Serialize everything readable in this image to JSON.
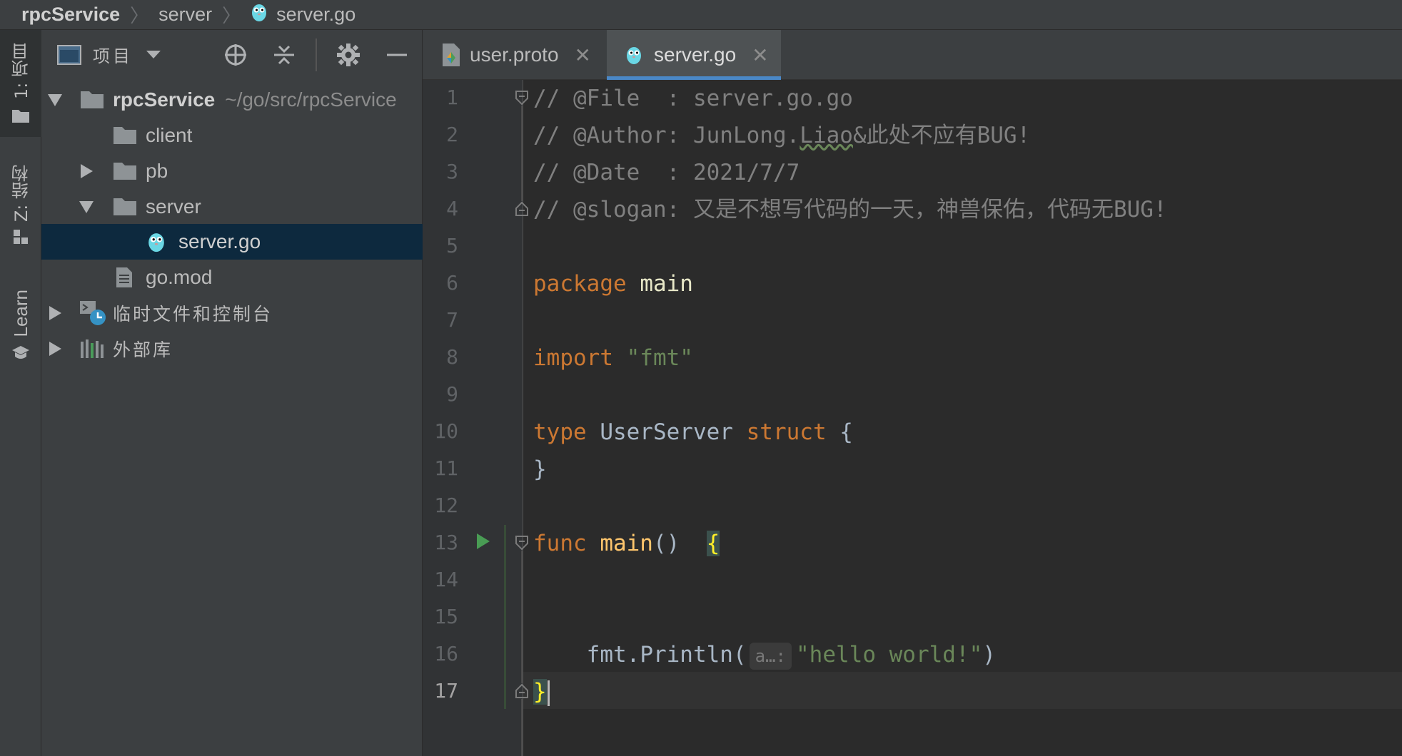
{
  "breadcrumb": {
    "items": [
      "rpcService",
      "server",
      "server.go"
    ]
  },
  "toolstrip": {
    "project": "1: 项目",
    "structure": "Z: 结构",
    "learn": "Learn"
  },
  "project_panel": {
    "title": "项目",
    "tree": [
      {
        "label": "rpcService",
        "path": "~/go/src/rpcService",
        "kind": "folder",
        "expanded": true
      },
      {
        "label": "client",
        "kind": "folder"
      },
      {
        "label": "pb",
        "kind": "folder",
        "expanded": false
      },
      {
        "label": "server",
        "kind": "folder",
        "expanded": true
      },
      {
        "label": "server.go",
        "kind": "go-file",
        "selected": true
      },
      {
        "label": "go.mod",
        "kind": "file"
      },
      {
        "label": "临时文件和控制台",
        "kind": "scratches"
      },
      {
        "label": "外部库",
        "kind": "libraries"
      }
    ]
  },
  "tabs": [
    {
      "label": "user.proto",
      "active": false
    },
    {
      "label": "server.go",
      "active": true
    }
  ],
  "editor": {
    "line_numbers": [
      "1",
      "2",
      "3",
      "4",
      "5",
      "6",
      "7",
      "8",
      "9",
      "10",
      "11",
      "12",
      "13",
      "14",
      "15",
      "16",
      "17"
    ],
    "current_line": "17",
    "lines": {
      "l1": "// @File  : server.go.go",
      "l2a": "// @Author: JunLong.",
      "l2b": "Liao",
      "l2c": "&此处不应有BUG!",
      "l3": "// @Date  : 2021/7/7",
      "l4": "// @slogan: 又是不想写代码的一天，神兽保佑，代码无BUG!",
      "l6_kw": "package",
      "l6_name": " main",
      "l8_kw": "import",
      "l8_str": " \"fmt\"",
      "l10_kw": "type",
      "l10_name": " UserServer ",
      "l10_kw2": "struct",
      "l10_brace": " {",
      "l11": "}",
      "l13_kw": "func",
      "l13_fn": " main",
      "l13_paren": "()  ",
      "l13_brace": "{",
      "l16_pkg": "    fmt.",
      "l16_fn": "Println",
      "l16_open": "(",
      "l16_hint": "a…:",
      "l16_str": "\"hello world!\"",
      "l16_close": ")",
      "l17": "}"
    }
  },
  "colors": {
    "keyword": "#cc7832",
    "string": "#6a8759",
    "comment": "#808080",
    "function": "#ffc66d",
    "selection": "#0d293e",
    "tab_underline": "#4a88c7",
    "run_arrow": "#499c54"
  }
}
